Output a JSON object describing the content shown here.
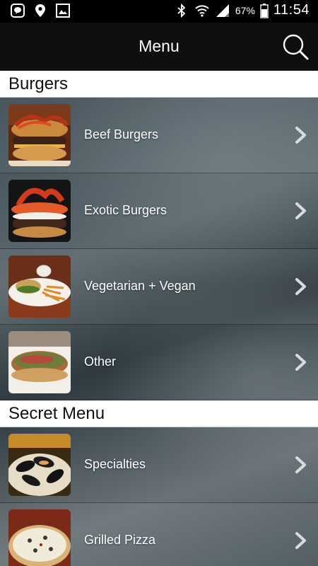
{
  "status_bar": {
    "icons_left": [
      "kakao-icon",
      "location-icon",
      "gallery-icon"
    ],
    "icons_right": [
      "bluetooth-icon",
      "wifi-icon",
      "signal-icon",
      "battery-icon"
    ],
    "battery": "67%",
    "time": "11:54"
  },
  "app_bar": {
    "title": "Menu",
    "search_icon": "search-icon"
  },
  "sections": [
    {
      "title": "Burgers",
      "items": [
        {
          "label": "Beef Burgers"
        },
        {
          "label": "Exotic Burgers"
        },
        {
          "label": "Vegetarian + Vegan"
        },
        {
          "label": "Other"
        }
      ]
    },
    {
      "title": "Secret Menu",
      "items": [
        {
          "label": "Specialties"
        },
        {
          "label": "Grilled Pizza"
        }
      ]
    }
  ],
  "colors": {
    "app_bar": "#0f0f0f",
    "section_header_bg": "#ffffff",
    "row_text": "#ffffff",
    "chevron": "#d9dcdd"
  }
}
